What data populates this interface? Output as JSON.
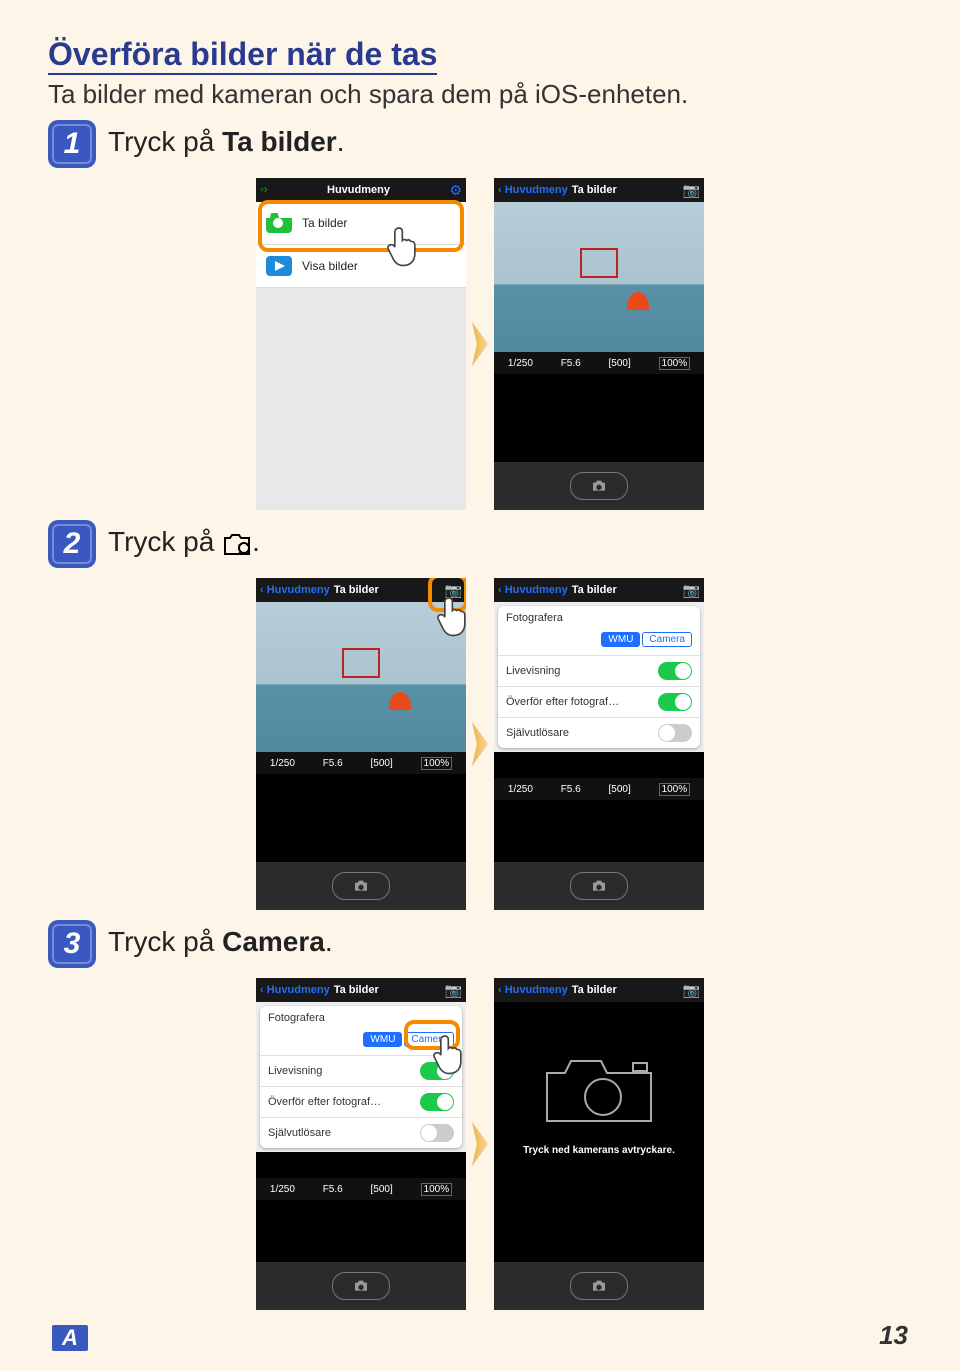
{
  "heading": "Överföra bilder när de tas",
  "intro": "Ta bilder med kameran och spara dem på iOS-enheten.",
  "steps": {
    "s1": {
      "num": "1",
      "before": "Tryck på ",
      "bold": "Ta bilder",
      "after": "."
    },
    "s2": {
      "num": "2",
      "before": "Tryck på ",
      "after": "."
    },
    "s3": {
      "num": "3",
      "before": "Tryck på ",
      "bold": "Camera",
      "after": "."
    }
  },
  "menu": {
    "header": "Huvudmeny",
    "item1": "Ta bilder",
    "item2": "Visa bilder"
  },
  "capture": {
    "back": "Huvudmeny",
    "title": "Ta bilder",
    "exif": {
      "shutter": "1/250",
      "aperture": "F5.6",
      "iso": "[500]",
      "zoom": "100%"
    }
  },
  "settings": {
    "panel_title": "Fotografera",
    "wmu": "WMU",
    "camera": "Camera",
    "live": "Livevisning",
    "after": "Överför efter fotograf…",
    "timer": "Självutlösare"
  },
  "outline_hint": "Tryck ned kamerans avtryckare.",
  "footer": {
    "badge": "A",
    "page": "13"
  }
}
